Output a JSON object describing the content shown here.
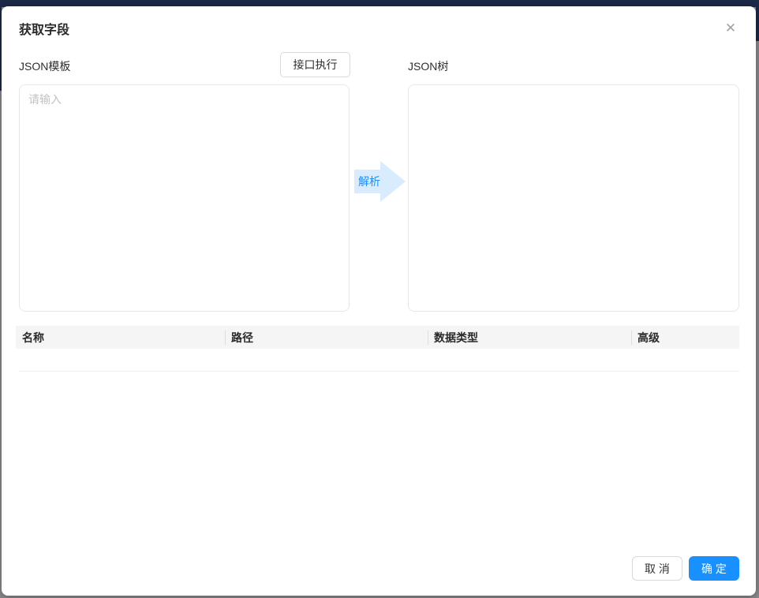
{
  "modal": {
    "title": "获取字段",
    "close_icon": "✕"
  },
  "template_section": {
    "label": "JSON模板",
    "execute_button_label": "接口执行",
    "textarea_value": "",
    "textarea_placeholder": "请输入",
    "parse_label": "解析"
  },
  "tree_section": {
    "label": "JSON树"
  },
  "table": {
    "columns": [
      {
        "label": "名称"
      },
      {
        "label": "路径"
      },
      {
        "label": "数据类型"
      },
      {
        "label": "高级"
      }
    ],
    "rows": []
  },
  "footer": {
    "cancel_label": "取 消",
    "confirm_label": "确 定"
  },
  "colors": {
    "accent_blue": "#1890ff",
    "arrow_fill": "#d9ecfd",
    "table_header_bg": "#f5f5f5",
    "backdrop_top_bar": "#1c2947",
    "backdrop_edge": "#8a8a8d"
  }
}
